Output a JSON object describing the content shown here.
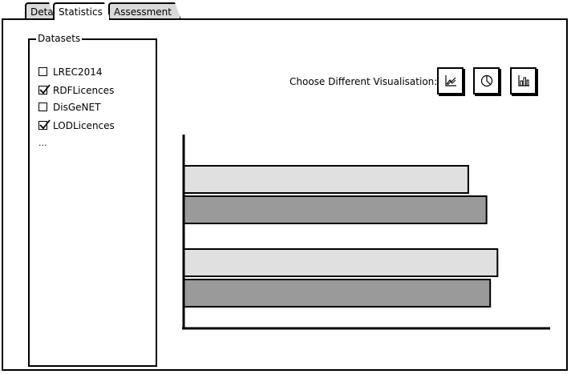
{
  "tabs": [
    {
      "label": "Detail",
      "active": false
    },
    {
      "label": "Statistics",
      "active": true
    },
    {
      "label": "Assessment",
      "active": false
    }
  ],
  "datasets": {
    "legend": "Datasets",
    "items": [
      {
        "label": "LREC2014",
        "checked": false
      },
      {
        "label": "RDFLicences",
        "checked": true
      },
      {
        "label": "DisGeNET",
        "checked": false
      },
      {
        "label": "LODLicences",
        "checked": true
      }
    ],
    "more": "..."
  },
  "visualisation": {
    "label": "Choose Different Visualisation:",
    "buttons": [
      {
        "icon": "line-chart-icon"
      },
      {
        "icon": "pie-chart-icon"
      },
      {
        "icon": "bar-chart-icon"
      }
    ]
  },
  "colors": {
    "series_light": "#e0e0e0",
    "series_dark": "#9a9a9a",
    "inactive_tab": "#d9d9d9"
  },
  "chart_data": {
    "type": "bar",
    "orientation": "horizontal",
    "categories": [
      "",
      ""
    ],
    "series": [
      {
        "values": [
          78,
          86
        ]
      },
      {
        "values": [
          83,
          84
        ]
      }
    ],
    "xlim": [
      0,
      100
    ],
    "grid": false,
    "legend": "none"
  }
}
